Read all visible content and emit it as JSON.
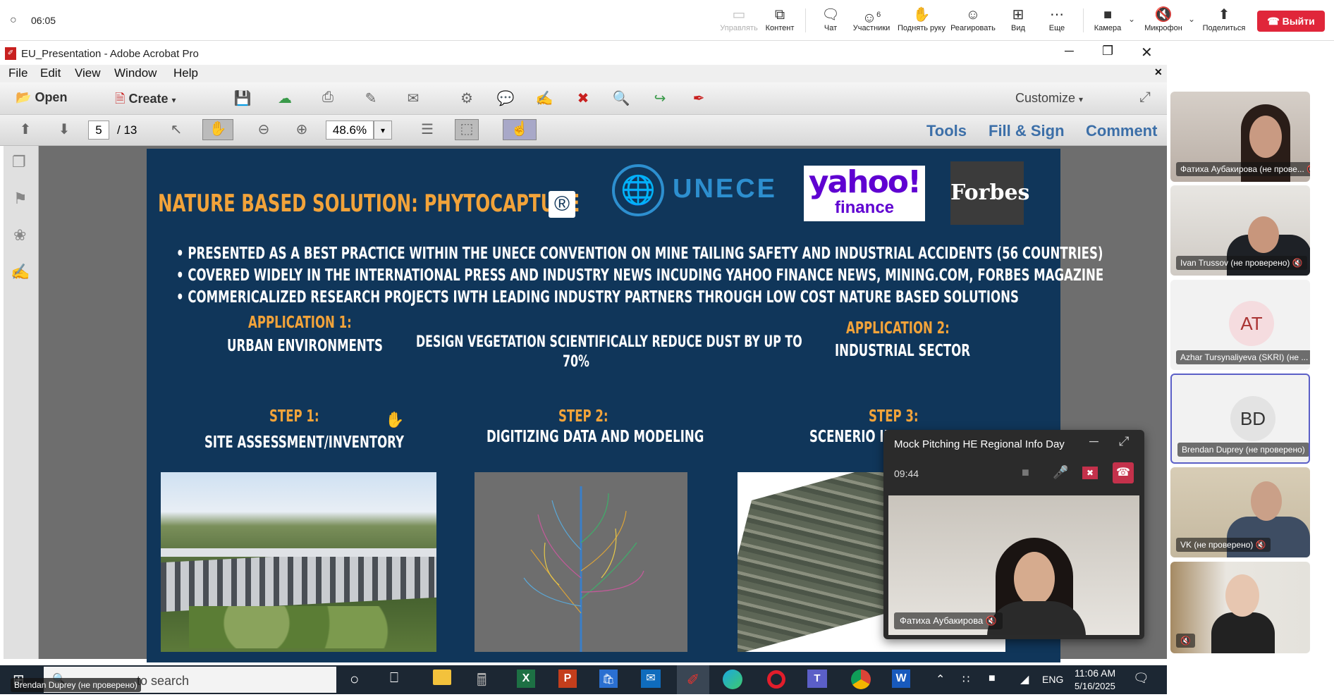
{
  "meeting": {
    "time": "06:05",
    "toolbar": [
      {
        "label": "Управлять",
        "icon": "screen-share-icon",
        "disabled": true
      },
      {
        "label": "Контент",
        "icon": "content-icon",
        "disabled": false
      },
      {
        "label": "Чат",
        "icon": "chat-icon",
        "disabled": false
      },
      {
        "label": "Участники",
        "icon": "participants-icon",
        "count": "6",
        "disabled": false
      },
      {
        "label": "Поднять руку",
        "icon": "raise-hand-icon",
        "disabled": false
      },
      {
        "label": "Реагировать",
        "icon": "react-icon",
        "disabled": false
      },
      {
        "label": "Вид",
        "icon": "view-icon",
        "disabled": false
      },
      {
        "label": "Еще",
        "icon": "more-icon",
        "disabled": false
      },
      {
        "label": "Камера",
        "icon": "camera-icon",
        "disabled": false
      },
      {
        "label": "Микрофон",
        "icon": "mic-off-icon",
        "disabled": false
      },
      {
        "label": "Поделиться",
        "icon": "share-icon",
        "disabled": false
      }
    ],
    "leave_label": "Выйти"
  },
  "acrobat": {
    "title": "EU_Presentation  - Adobe Acrobat Pro",
    "menu": [
      "File",
      "Edit",
      "View",
      "Window",
      "Help"
    ],
    "open_label": "Open",
    "create_label": "Create",
    "customize_label": "Customize",
    "page_current": "5",
    "page_total": "/ 13",
    "zoom": "48.6%",
    "tools_label": "Tools",
    "fillsign_label": "Fill & Sign",
    "comment_label": "Comment"
  },
  "slide": {
    "title": "NATURE BASED SOLUTION: PHYTOCAPTURE",
    "registered": "®",
    "logos": {
      "unece": "UNECE",
      "yahoo1": "yahoo!",
      "yahoo2": "finance",
      "forbes": "Forbes"
    },
    "bullets": [
      "PRESENTED AS A BEST PRACTICE WITHIN THE UNECE CONVENTION ON MINE TAILING SAFETY AND INDUSTRIAL ACCIDENTS  (56 COUNTRIES)",
      "COVERED WIDELY IN THE INTERNATIONAL PRESS AND INDUSTRY NEWS INCUDING YAHOO FINANCE NEWS, MINING.COM, FORBES MAGAZINE",
      "COMMERICALIZED RESEARCH PROJECTS IWTH LEADING INDUSTRY  PARTNERS THROUGH LOW COST NATURE BASED SOLUTIONS"
    ],
    "app1_title": "APPLICATION 1:",
    "app1_text": "URBAN ENVIRONMENTS",
    "middle_text1": "DESIGN VEGETATION SCIENTIFICALLY REDUCE DUST BY UP TO",
    "middle_text2": "70%",
    "app2_title": "APPLICATION 2:",
    "app2_text": "INDUSTRIAL SECTOR",
    "step1_title": "STEP 1:",
    "step1_text": "SITE ASSESSMENT/INVENTORY",
    "step2_title": "STEP 2:",
    "step2_text": "DIGITIZING DATA AND MODELING",
    "step3_title": "STEP 3:",
    "step3_text": "SCENERIO IM"
  },
  "taskbar": {
    "search": "to search",
    "speaker_label": "Brendan Duprey (не проверено)",
    "lang": "ENG",
    "time": "11:06 AM",
    "date": "5/16/2025"
  },
  "participants": [
    {
      "name": "Фатиха Аубакирова (не прове...",
      "type": "video"
    },
    {
      "name": "Ivan Trussov (не проверено)",
      "type": "video"
    },
    {
      "name": "Azhar Tursynaliyeva (SKRI) (не ...",
      "type": "avatar",
      "initials": "AT"
    },
    {
      "name": "Brendan Duprey (не проверено)",
      "type": "avatar",
      "initials": "BD"
    },
    {
      "name": "VK (не проверено)",
      "type": "video"
    },
    {
      "name": "",
      "type": "video"
    }
  ],
  "floating": {
    "title": "Mock Pitching HE Regional Info Day",
    "timer": "09:44",
    "speaker": "Фатиха Аубакирова"
  }
}
